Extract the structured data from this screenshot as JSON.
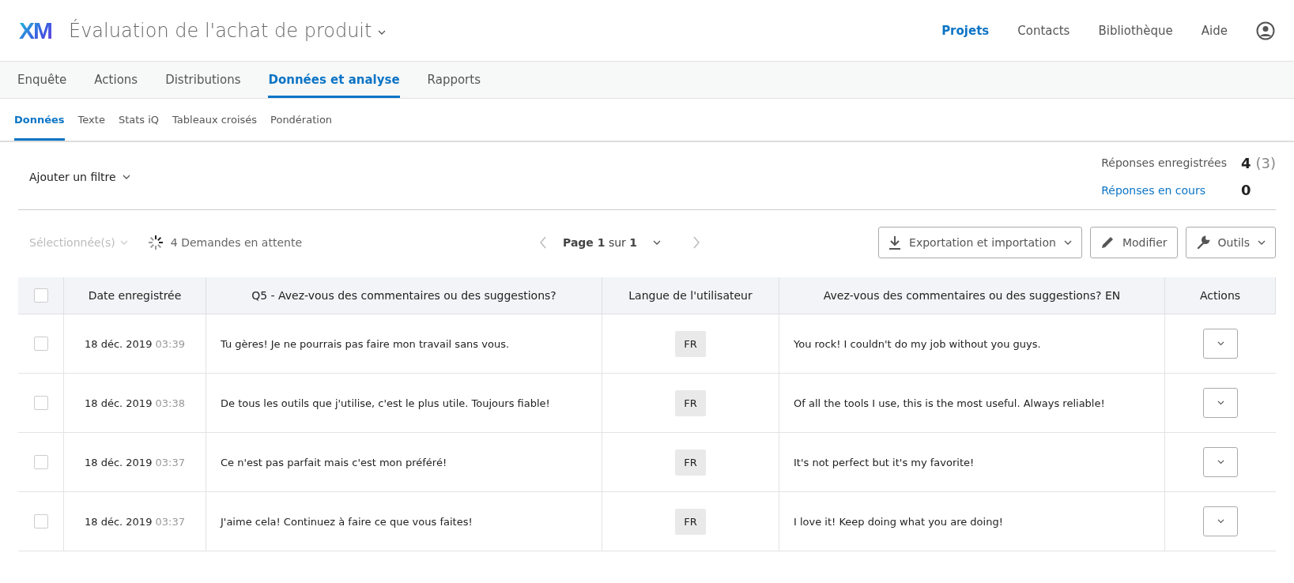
{
  "header": {
    "logo": "XM",
    "project_title": "Évaluation de l'achat de produit",
    "nav": [
      {
        "label": "Projets",
        "selected": true
      },
      {
        "label": "Contacts",
        "selected": false
      },
      {
        "label": "Bibliothèque",
        "selected": false
      },
      {
        "label": "Aide",
        "selected": false
      }
    ]
  },
  "tabs": [
    {
      "label": "Enquête",
      "selected": false
    },
    {
      "label": "Actions",
      "selected": false
    },
    {
      "label": "Distributions",
      "selected": false
    },
    {
      "label": "Données et analyse",
      "selected": true
    },
    {
      "label": "Rapports",
      "selected": false
    }
  ],
  "subtabs": [
    {
      "label": "Données",
      "selected": true
    },
    {
      "label": "Texte",
      "selected": false
    },
    {
      "label": "Stats iQ",
      "selected": false
    },
    {
      "label": "Tableaux croisés",
      "selected": false
    },
    {
      "label": "Pondération",
      "selected": false
    }
  ],
  "filter": {
    "label": "Ajouter un filtre"
  },
  "summary": {
    "recorded_label": "Réponses enregistrées",
    "recorded_count": "4",
    "recorded_extra": "(3)",
    "in_progress_label": "Réponses en cours",
    "in_progress_count": "0"
  },
  "toolbar": {
    "selected_label": "Sélectionnée(s)",
    "pending": "4 Demandes en attente",
    "page": "**Page 1** sur **1**",
    "buttons": [
      {
        "label": "Exportation et importation",
        "kind": "download",
        "dropdown": true
      },
      {
        "label": "Modifier",
        "kind": "edit",
        "dropdown": false
      },
      {
        "label": "Outils",
        "kind": "tools",
        "dropdown": true
      }
    ]
  },
  "table": {
    "select_all_checked": false,
    "columns": [
      "Date enregistrée",
      "Q5 - Avez-vous des commentaires ou des suggestions?",
      "Langue de l'utilisateur",
      "Avez-vous des commentaires ou des suggestions? EN",
      "Actions"
    ],
    "rows": [
      {
        "checked": false,
        "date": "18 déc. 2019",
        "time": "03:39",
        "q5": "Tu gères! Je ne pourrais pas faire mon travail sans vous.",
        "lang": "FR",
        "en": "You rock! I couldn't do my job without you guys."
      },
      {
        "checked": false,
        "date": "18 déc. 2019",
        "time": "03:38",
        "q5": "De tous les outils que j'utilise, c'est le plus utile. Toujours fiable!",
        "lang": "FR",
        "en": "Of all the tools I use, this is the most useful. Always reliable!"
      },
      {
        "checked": false,
        "date": "18 déc. 2019",
        "time": "03:37",
        "q5": "Ce n'est pas parfait mais c'est mon préféré!",
        "lang": "FR",
        "en": "It's not perfect but it's my favorite!"
      },
      {
        "checked": false,
        "date": "18 déc. 2019",
        "time": "03:37",
        "q5": "J'aime cela! Continuez à faire ce que vous faites!",
        "lang": "FR",
        "en": "I love it! Keep doing what you are doing!"
      }
    ]
  }
}
